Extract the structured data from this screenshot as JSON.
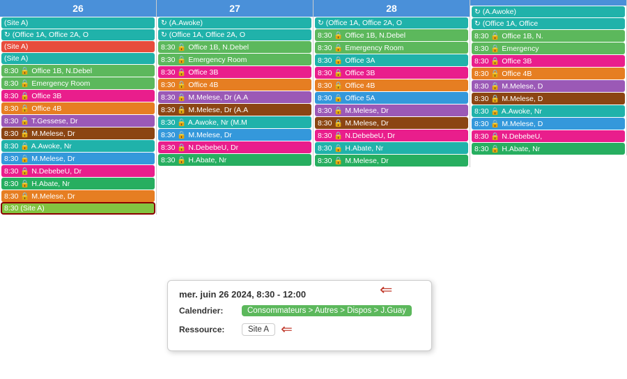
{
  "calendar": {
    "columns": [
      {
        "id": "col26",
        "header": "26",
        "events": [
          {
            "text": "(Site A)",
            "color": "teal"
          },
          {
            "text": "↻ (Office 1A, Office 2A, O",
            "color": "teal"
          },
          {
            "text": "(Site A)",
            "color": "red",
            "special": true
          },
          {
            "text": "(Site A)",
            "color": "teal"
          },
          {
            "text": "8:30 🔒 Office 1B, N.Debel",
            "color": "green"
          },
          {
            "text": "8:30 🔒 Emergency Room",
            "color": "green"
          },
          {
            "text": "8:30 🔒 Office 3B",
            "color": "pink"
          },
          {
            "text": "8:30 🔒 Office 4B",
            "color": "orange"
          },
          {
            "text": "8:30 🔒 T.Gessese, Dr",
            "color": "purple"
          },
          {
            "text": "8:30 🔒 M.Melese, Dr",
            "color": "brown"
          },
          {
            "text": "8:30 🔒 A.Awoke, Nr",
            "color": "teal"
          },
          {
            "text": "8:30 🔒 M.Melese, Dr",
            "color": "blue"
          },
          {
            "text": "8:30 🔒 N.DebebeU, Dr",
            "color": "pink"
          },
          {
            "text": "8:30 🔒 H.Abate, Nr",
            "color": "dark-green"
          },
          {
            "text": "8:30 🔒 M.Melese, Dr",
            "color": "orange"
          },
          {
            "text": "8:30 (Site A)",
            "color": "light-green",
            "selected": true
          }
        ]
      },
      {
        "id": "col27",
        "header": "27",
        "events": [
          {
            "text": "↻ (A.Awoke)",
            "color": "teal"
          },
          {
            "text": "↻ (Office 1A, Office 2A, O",
            "color": "teal"
          },
          {
            "text": "8:30 🔒 Office 1B, N.Debel",
            "color": "green"
          },
          {
            "text": "8:30 🔒 Emergency Room",
            "color": "green"
          },
          {
            "text": "8:30 🔒 Office 3B",
            "color": "pink"
          },
          {
            "text": "8:30 🔒 Office 4B",
            "color": "orange"
          },
          {
            "text": "8:30 🔒 M.Melese, Dr (A.A",
            "color": "purple"
          },
          {
            "text": "8:30 🔒 M.Melese, Dr (A.A",
            "color": "brown"
          },
          {
            "text": "8:30 🔒 A.Awoke, Nr (M.M",
            "color": "teal"
          },
          {
            "text": "8:30 🔒 M.Melese, Dr",
            "color": "blue"
          },
          {
            "text": "8:30 🔒 N.DebebeU, Dr",
            "color": "pink"
          },
          {
            "text": "8:30 🔒 H.Abate, Nr",
            "color": "dark-green"
          }
        ]
      },
      {
        "id": "col28",
        "header": "28",
        "events": [
          {
            "text": "↻ (Office 1A, Office 2A, O",
            "color": "teal"
          },
          {
            "text": "8:30 🔒 Office 1B, N.Debel",
            "color": "green"
          },
          {
            "text": "8:30 🔒 Emergency Room",
            "color": "green"
          },
          {
            "text": "8:30 🔒 Office 3A",
            "color": "teal"
          },
          {
            "text": "8:30 🔒 Office 3B",
            "color": "pink"
          },
          {
            "text": "8:30 🔒 Office 4B",
            "color": "orange"
          },
          {
            "text": "8:30 🔒 Office 5A",
            "color": "blue"
          },
          {
            "text": "8:30 🔒 M.Melese, Dr",
            "color": "purple"
          },
          {
            "text": "8:30 🔒 M.Melese, Dr",
            "color": "brown"
          },
          {
            "text": "8:30 🔒 N.DebebeU, Dr",
            "color": "pink"
          },
          {
            "text": "8:30 🔒 H.Abate, Nr",
            "color": "teal"
          },
          {
            "text": "8:30 🔒 M.Melese, Dr",
            "color": "dark-green"
          }
        ]
      },
      {
        "id": "col29",
        "header": "",
        "events": [
          {
            "text": "↻ (A.Awoke)",
            "color": "teal"
          },
          {
            "text": "↻ (Office 1A, Office",
            "color": "teal"
          },
          {
            "text": "8:30 🔒 Office 1B, N.",
            "color": "green"
          },
          {
            "text": "8:30 🔒 Emergency",
            "color": "green"
          },
          {
            "text": "8:30 🔒 Office 3B",
            "color": "pink"
          },
          {
            "text": "8:30 🔒 Office 4B",
            "color": "orange"
          },
          {
            "text": "8:30 🔒 M.Melese, D",
            "color": "purple"
          },
          {
            "text": "8:30 🔒 M.Melese, D",
            "color": "brown"
          },
          {
            "text": "8:30 🔒 A.Awoke, Nr",
            "color": "teal"
          },
          {
            "text": "8:30 🔒 M.Melese, D",
            "color": "blue"
          },
          {
            "text": "8:30 🔒 N.DebebeU,",
            "color": "pink"
          },
          {
            "text": "8:30 🔒 H.Abate, Nr",
            "color": "dark-green"
          }
        ]
      }
    ],
    "tooltip": {
      "title": "mer. juin 26 2024, 8:30 - 12:00",
      "calendar_label": "Calendrier:",
      "calendar_value": "Consommateurs > Autres > Dispos > J.Guay",
      "resource_label": "Ressource:",
      "resource_value": "Site A"
    }
  }
}
